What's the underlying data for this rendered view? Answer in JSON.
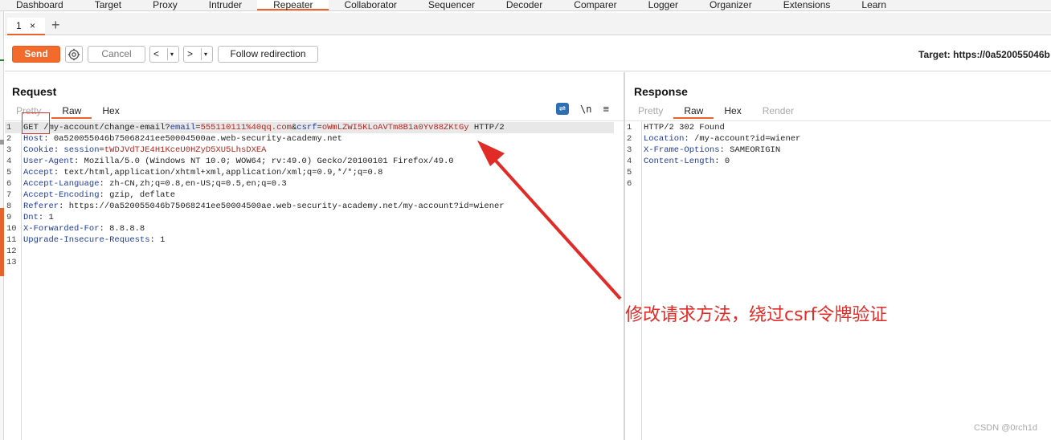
{
  "nav": [
    "Dashboard",
    "Target",
    "Proxy",
    "Intruder",
    "Repeater",
    "Collaborator",
    "Sequencer",
    "Decoder",
    "Comparer",
    "Logger",
    "Organizer",
    "Extensions",
    "Learn"
  ],
  "tab": {
    "label": "1",
    "close": "×",
    "add": "+"
  },
  "toolbar": {
    "send": "Send",
    "cancel": "Cancel",
    "back": "<",
    "forward": ">",
    "dropdown": "▾",
    "follow": "Follow redirection",
    "target": "Target: https://0a520055046b"
  },
  "request": {
    "title": "Request",
    "tabs": [
      "Pretty",
      "Raw",
      "Hex"
    ],
    "newline_label": "\\n",
    "menu_label": "≡",
    "wrap_label": "⇌",
    "lines": [
      [
        [
          "GET",
          ""
        ],
        [
          " /my-account/change-email?",
          ""
        ],
        [
          "email",
          "hdr"
        ],
        [
          "=",
          ""
        ],
        [
          "555110111%40qq.com",
          "val"
        ],
        [
          "&",
          ""
        ],
        [
          "csrf",
          "hdr"
        ],
        [
          "=",
          ""
        ],
        [
          "oWmLZWI5KLoAVTm8B1a0Yv88ZKtGy",
          "val"
        ],
        [
          " HTTP/2",
          ""
        ]
      ],
      [
        [
          "Host",
          "hdr"
        ],
        [
          ": 0a520055046b75068241ee50004500ae.web-security-academy.net",
          ""
        ]
      ],
      [
        [
          "Cookie",
          "hdr"
        ],
        [
          ": ",
          ""
        ],
        [
          "session",
          "hdr"
        ],
        [
          "=",
          ""
        ],
        [
          "tWDJVdTJE4H1KceU0HZyD5XU5LhsDXEA",
          "val"
        ]
      ],
      [
        [
          "User-Agent",
          "hdr"
        ],
        [
          ": Mozilla/5.0 (Windows NT 10.0; WOW64; rv:49.0) Gecko/20100101 Firefox/49.0",
          ""
        ]
      ],
      [
        [
          "Accept",
          "hdr"
        ],
        [
          ": text/html,application/xhtml+xml,application/xml;q=0.9,*/*;q=0.8",
          ""
        ]
      ],
      [
        [
          "Accept-Language",
          "hdr"
        ],
        [
          ": zh-CN,zh;q=0.8,en-US;q=0.5,en;q=0.3",
          ""
        ]
      ],
      [
        [
          "Accept-Encoding",
          "hdr"
        ],
        [
          ": gzip, deflate",
          ""
        ]
      ],
      [
        [
          "Referer",
          "hdr"
        ],
        [
          ": https://0a520055046b75068241ee50004500ae.web-security-academy.net/my-account?id=wiener",
          ""
        ]
      ],
      [
        [
          "Dnt",
          "hdr"
        ],
        [
          ": 1",
          ""
        ]
      ],
      [
        [
          "X-Forwarded-For",
          "hdr"
        ],
        [
          ": 8.8.8.8",
          ""
        ]
      ],
      [
        [
          "Upgrade-Insecure-Requests",
          "hdr"
        ],
        [
          ": 1",
          ""
        ]
      ],
      [],
      []
    ]
  },
  "response": {
    "title": "Response",
    "tabs": [
      "Pretty",
      "Raw",
      "Hex",
      "Render"
    ],
    "lines": [
      [
        [
          "HTTP/2 302 Found",
          ""
        ]
      ],
      [
        [
          "Location",
          "hdr"
        ],
        [
          ": /my-account?id=wiener",
          ""
        ]
      ],
      [
        [
          "X-Frame-Options",
          "hdr"
        ],
        [
          ": SAMEORIGIN",
          ""
        ]
      ],
      [
        [
          "Content-Length",
          "hdr"
        ],
        [
          ": 0",
          ""
        ]
      ],
      [],
      []
    ]
  },
  "annotation": "修改请求方法，绕过csrf令牌验证",
  "watermark": "CSDN @0rch1d",
  "colors": {
    "accent": "#e8622c",
    "send": "#f26a2c",
    "header_name": "#1f3a9c",
    "value": "#b3261e",
    "annotation": "#e02b27"
  }
}
